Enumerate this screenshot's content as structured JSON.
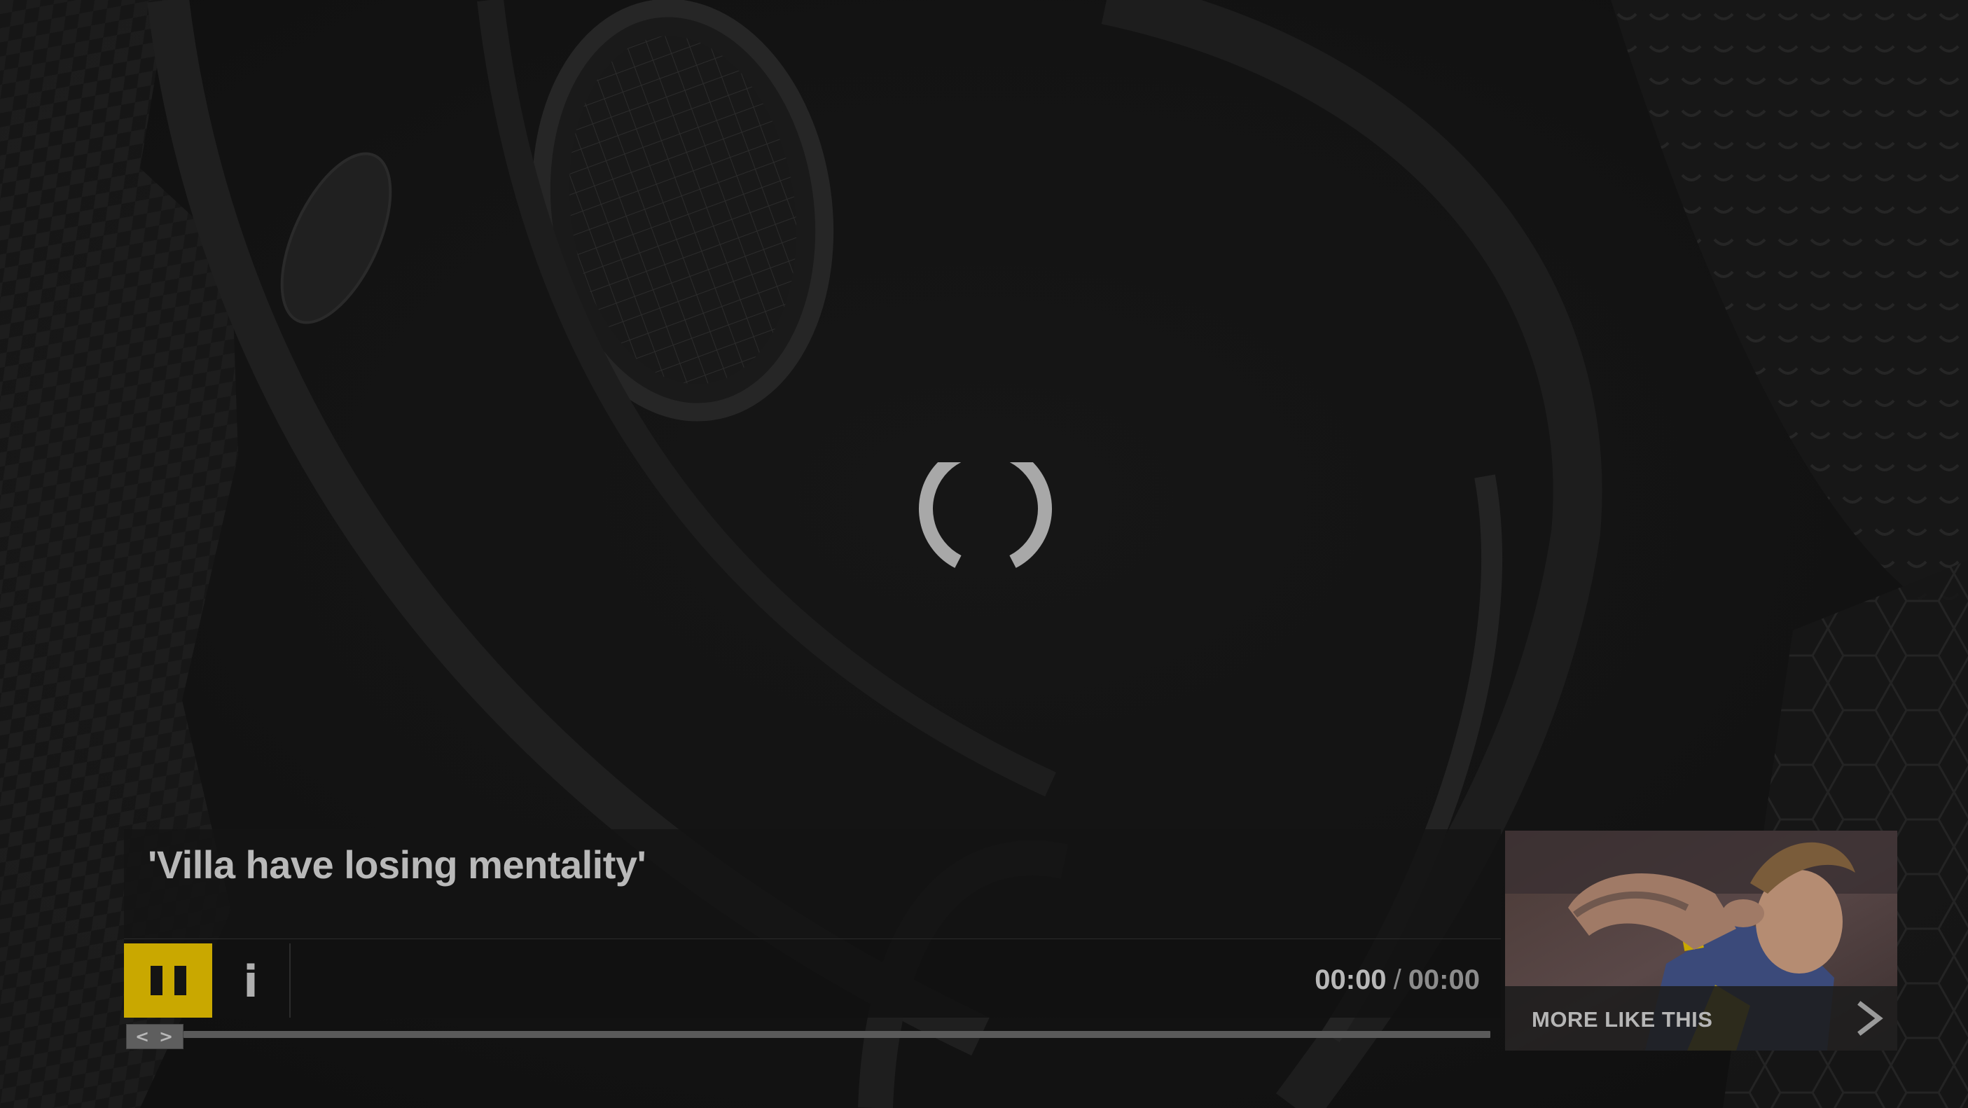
{
  "video": {
    "title": "'Villa have losing mentality'",
    "state": "loading",
    "progress_percent": 0
  },
  "controls": {
    "pause_icon": "pause-icon",
    "info_label": "i",
    "current_time": "00:00",
    "time_separator": "/",
    "duration": "00:00",
    "scrub_left_glyph": "<",
    "scrub_right_glyph": ">"
  },
  "more_like_this": {
    "label": "MORE LIKE THIS",
    "arrow_icon": "chevron-right-icon"
  },
  "colors": {
    "accent": "#c9a800",
    "background": "#141414",
    "text": "#b9b9b9"
  }
}
